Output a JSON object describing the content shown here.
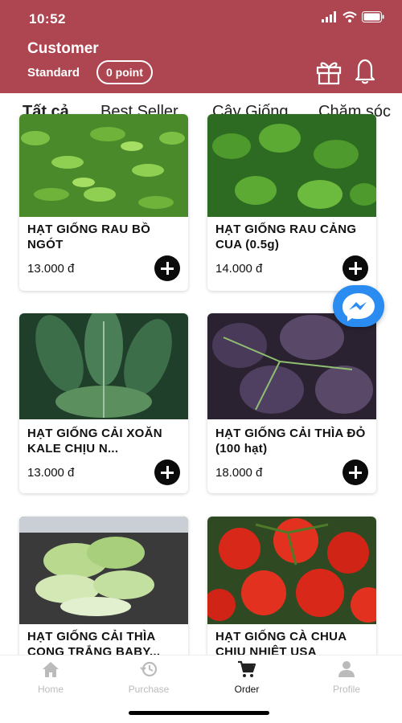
{
  "status": {
    "time": "10:52"
  },
  "header": {
    "customer_name": "Customer",
    "tier": "Standard",
    "points": "0 point",
    "gift_icon": "gift-icon",
    "bell_icon": "bell-icon",
    "bg_color": "#ad4650"
  },
  "tabs": [
    {
      "label": "Tất cả",
      "active": true
    },
    {
      "label": "Best Seller",
      "active": false
    },
    {
      "label": "Cây Giống",
      "active": false
    },
    {
      "label": "Chăm sóc",
      "active": false
    }
  ],
  "products": [
    {
      "title": "HẠT GIỐNG RAU BỒ NGÓT",
      "price": "13.000 đ"
    },
    {
      "title": "HẠT GIỐNG RAU CẢNG CUA (0.5g)",
      "price": "14.000 đ"
    },
    {
      "title": "HẠT GIỐNG CẢI XOĂN KALE CHỊU N...",
      "price": "13.000 đ"
    },
    {
      "title": "HẠT GIỐNG CẢI THÌA ĐỎ (100 hạt)",
      "price": "18.000 đ"
    },
    {
      "title": "HẠT GIỐNG CẢI THÌA CỌNG TRẮNG BABY...",
      "price": ""
    },
    {
      "title": "HẠT GIỐNG CÀ CHUA CHỊU NHIỆT USA",
      "price": ""
    }
  ],
  "bottom_nav": [
    {
      "label": "Home",
      "icon": "home-icon",
      "active": false
    },
    {
      "label": "Purchase",
      "icon": "history-icon",
      "active": false
    },
    {
      "label": "Order",
      "icon": "cart-icon",
      "active": true
    },
    {
      "label": "Profile",
      "icon": "person-icon",
      "active": false
    }
  ]
}
